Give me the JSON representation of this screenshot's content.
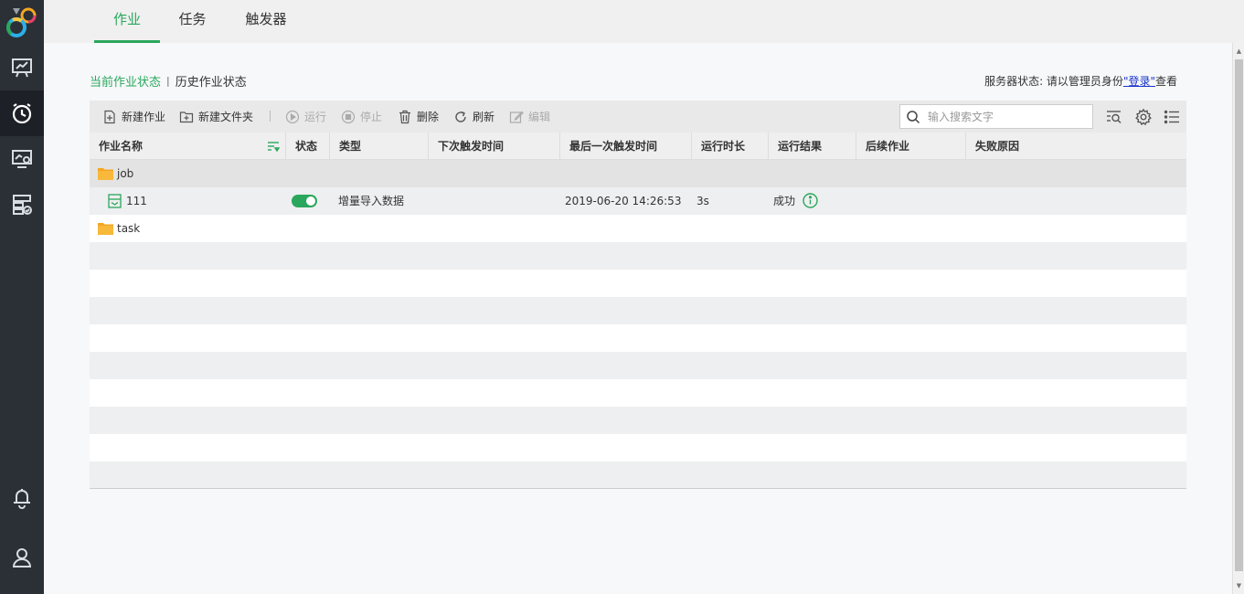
{
  "tabs": [
    {
      "label": "作业",
      "active": true
    },
    {
      "label": "任务",
      "active": false
    },
    {
      "label": "触发器",
      "active": false
    }
  ],
  "status_links": {
    "current": "当前作业状态",
    "separator": "|",
    "history": "历史作业状态"
  },
  "server_status": {
    "prefix": "服务器状态: 请以管理员身份",
    "link": "\"登录\"",
    "suffix": "查看"
  },
  "toolbar": {
    "new_job": "新建作业",
    "new_folder": "新建文件夹",
    "run": "运行",
    "stop": "停止",
    "delete": "删除",
    "refresh": "刷新",
    "edit": "编辑",
    "search_placeholder": "输入搜索文字"
  },
  "columns": [
    "作业名称",
    "状态",
    "类型",
    "下次触发时间",
    "最后一次触发时间",
    "运行时长",
    "运行结果",
    "后续作业",
    "失败原因"
  ],
  "rows": {
    "folder_job": {
      "name": "job"
    },
    "job_111": {
      "name": "111",
      "status": "on",
      "type": "增量导入数据",
      "next_trigger": "",
      "last_trigger": "2019-06-20 14:26:53",
      "duration": "3s",
      "result": "成功",
      "next_job": "",
      "fail_reason": ""
    },
    "folder_task": {
      "name": "task"
    }
  },
  "colors": {
    "accent": "#2aa75c",
    "sidebar": "#2b2f36",
    "folder": "#f5a623"
  }
}
